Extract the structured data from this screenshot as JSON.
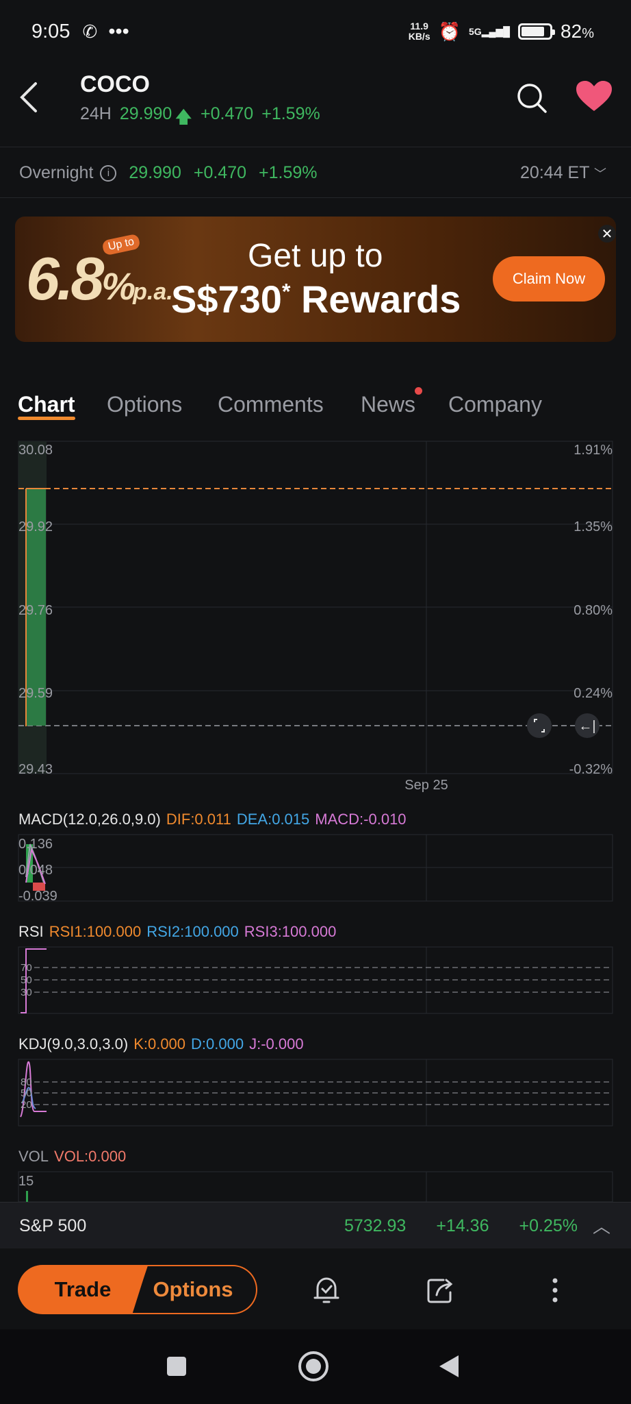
{
  "status_bar": {
    "time": "9:05",
    "speed": "11.9",
    "speed_unit": "KB/s",
    "network": "5G",
    "battery": "82",
    "battery_unit": "%",
    "battery_level": 0.82
  },
  "header": {
    "ticker": "COCO",
    "session": "24H",
    "price": "29.990",
    "change": "+0.470",
    "change_pct": "+1.59%"
  },
  "overnight": {
    "label": "Overnight",
    "price": "29.990",
    "change": "+0.470",
    "change_pct": "+1.59%",
    "time": "20:44 ET"
  },
  "banner": {
    "rate": "6.8",
    "rate_unit": "%",
    "rate_suffix": "p.a.",
    "upto": "Up to",
    "line1": "Get up to",
    "line2_amount": "S$730",
    "line2_mark": "*",
    "line2_text": "Rewards",
    "cta": "Claim Now"
  },
  "tabs": [
    "Chart",
    "Options",
    "Comments",
    "News",
    "Company"
  ],
  "chart": {
    "price_ticks": [
      "30.08",
      "29.92",
      "29.76",
      "29.59",
      "29.43"
    ],
    "pct_ticks": [
      "1.91%",
      "1.35%",
      "0.80%",
      "0.24%",
      "-0.32%"
    ],
    "x_label": "Sep 25",
    "macd": {
      "name": "MACD(12.0,26.0,9.0)",
      "dif": "DIF:0.011",
      "dea": "DEA:0.015",
      "macd": "MACD:-0.010",
      "ticks": [
        "0.136",
        "0.048",
        "-0.039"
      ]
    },
    "rsi": {
      "name": "RSI",
      "rsi1": "RSI1:100.000",
      "rsi2": "RSI2:100.000",
      "rsi3": "RSI3:100.000",
      "ticks": [
        "70",
        "50",
        "30"
      ]
    },
    "kdj": {
      "name": "KDJ(9.0,3.0,3.0)",
      "k": "K:0.000",
      "d": "D:0.000",
      "j": "J:-0.000",
      "ticks": [
        "80",
        "50",
        "20"
      ]
    },
    "vol": {
      "name": "VOL",
      "vol": "VOL:0.000",
      "ticks": [
        "15"
      ]
    }
  },
  "index_bar": {
    "name": "S&P 500",
    "value": "5732.93",
    "change": "+14.36",
    "change_pct": "+0.25%"
  },
  "actions": {
    "trade": "Trade",
    "options": "Options"
  },
  "colors": {
    "accent": "#ee6a20",
    "up": "#3fb860",
    "background": "#111214"
  }
}
